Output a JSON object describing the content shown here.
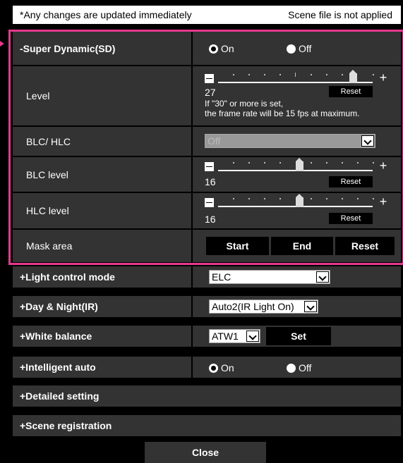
{
  "header": {
    "notice": "*Any changes are updated immediately",
    "scene_status": "Scene file is not applied"
  },
  "super_dynamic": {
    "label": "-Super Dynamic(SD)",
    "on_label": "On",
    "off_label": "Off",
    "selected": "On"
  },
  "level": {
    "label": "Level",
    "value": "27",
    "reset": "Reset",
    "note_line1": "If \"30\" or more is set,",
    "note_line2": "the frame rate will be 15 fps at maximum."
  },
  "blc_hlc": {
    "label": "BLC/ HLC",
    "value": "Off"
  },
  "blc_level": {
    "label": "BLC level",
    "value": "16",
    "reset": "Reset"
  },
  "hlc_level": {
    "label": "HLC level",
    "value": "16",
    "reset": "Reset"
  },
  "mask_area": {
    "label": "Mask area",
    "start": "Start",
    "end": "End",
    "reset": "Reset"
  },
  "light_control": {
    "label": "+Light control mode",
    "value": "ELC"
  },
  "day_night": {
    "label": "+Day & Night(IR)",
    "value": "Auto2(IR Light On)"
  },
  "white_balance": {
    "label": "+White balance",
    "value": "ATW1",
    "set": "Set"
  },
  "intelligent_auto": {
    "label": "+Intelligent auto",
    "on_label": "On",
    "off_label": "Off",
    "selected": "On"
  },
  "detailed_setting": {
    "label": "+Detailed setting"
  },
  "scene_registration": {
    "label": "+Scene registration"
  },
  "close": "Close",
  "colors": {
    "highlight_frame": "#e5388f",
    "cell_bg": "#333333"
  }
}
